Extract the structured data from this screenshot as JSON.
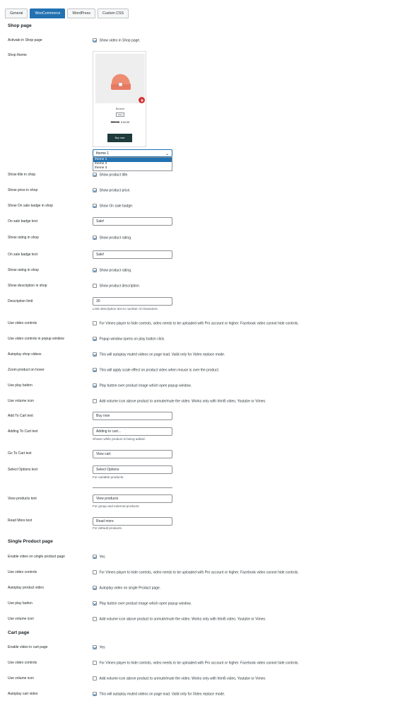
{
  "tabs": [
    "General",
    "WooCommerce",
    "WordPress",
    "Custom CSS"
  ],
  "active_tab": 1,
  "sections": {
    "shop": "Shop page",
    "single": "Single Product page",
    "cart": "Cart page"
  },
  "preview": {
    "product_name": "Beanie",
    "badge": "Sale!",
    "old_price": "£20.00",
    "price": "£18.00",
    "button": "Buy now"
  },
  "theme_select": {
    "value": "theme 1",
    "options": [
      "theme 1",
      "theme 2",
      "theme 3"
    ]
  },
  "shop_rows": [
    {
      "label": "Activate in Shop page",
      "type": "checkbox",
      "checked": true,
      "text": "Show video in Shop page."
    },
    {
      "label": "Shop theme"
    },
    {
      "label": "Show title in shop",
      "type": "checkbox",
      "checked": true,
      "text": "Show product title."
    },
    {
      "label": "Show price in shop",
      "type": "checkbox",
      "checked": true,
      "text": "Show product price."
    },
    {
      "label": "Show On sale badge in shop",
      "type": "checkbox",
      "checked": true,
      "text": "Show On sale badge."
    },
    {
      "label": "On sale badge text",
      "type": "input",
      "value": "Sale!"
    },
    {
      "label": "Show rating in shop",
      "type": "checkbox",
      "checked": true,
      "text": "Show product rating."
    },
    {
      "label": "On sale badge text",
      "type": "input",
      "value": "Sale!"
    },
    {
      "label": "Show rating in shop",
      "type": "checkbox",
      "checked": true,
      "text": "Show product rating."
    },
    {
      "label": "Show description in shop",
      "type": "checkbox",
      "checked": false,
      "text": "Show product description."
    },
    {
      "label": "Description limit",
      "type": "input",
      "value": "30",
      "desc": "Limit description text to number of characters."
    },
    {
      "label": "Use video controls",
      "type": "checkbox",
      "checked": false,
      "text": "For Vimeo player to hide controls, video needs to be uploaded with Pro account or higher. Facebook video cannot hide controls."
    },
    {
      "label": "Use video controls in popup window",
      "type": "checkbox",
      "checked": true,
      "text": "Popup window opens on play button click."
    },
    {
      "label": "Autoplay shop videos",
      "type": "checkbox",
      "checked": true,
      "text": "This will autoplay muted videos on page load. Valid only for Video replace mode."
    },
    {
      "label": "Zoom product on hover",
      "type": "checkbox",
      "checked": true,
      "text": "This will apply scale effect on product video when mouse is over the product."
    },
    {
      "label": "Use play button",
      "type": "checkbox",
      "checked": true,
      "text": "Play button over product image which open popup window."
    },
    {
      "label": "Use volume icon",
      "type": "checkbox",
      "checked": false,
      "text": "Add volume icon above product to unmute/mute the video. Works only with html5 video, Youtube or Vimeo."
    },
    {
      "label": "Add To Cart text",
      "type": "input",
      "value": "Buy now"
    },
    {
      "label": "Adding To Cart text",
      "type": "input",
      "value": "Adding to cart...",
      "desc": "Shown while product is being added."
    },
    {
      "label": "Go To Cart text",
      "type": "input",
      "value": "View cart"
    },
    {
      "label": "Select Options text",
      "type": "input",
      "value": "Select Options",
      "desc": "For variable products."
    },
    {
      "label": "View products text",
      "type": "input",
      "value": "View products",
      "desc": "For group and external products."
    },
    {
      "label": "Read More text",
      "type": "input",
      "value": "Read more",
      "desc": "For default products."
    }
  ],
  "single_rows": [
    {
      "label": "Enable video on single product page",
      "type": "checkbox",
      "checked": true,
      "text": "Yes"
    },
    {
      "label": "Use video controls",
      "type": "checkbox",
      "checked": false,
      "text": "For Vimeo player to hide controls, video needs to be uploaded with Pro account or higher. Facebook video cannot hide controls."
    },
    {
      "label": "Autoplay product video",
      "type": "checkbox",
      "checked": true,
      "text": "Autoplay video on single Product page."
    },
    {
      "label": "Use play button",
      "type": "checkbox",
      "checked": true,
      "text": "Play button over product image which open popup window."
    },
    {
      "label": "Use volume icon",
      "type": "checkbox",
      "checked": false,
      "text": "Add volume icon above product to unmute/mute the video. Works only with html5 video, Youtube or Vimeo."
    }
  ],
  "cart_rows": [
    {
      "label": "Enable video in cart page",
      "type": "checkbox",
      "checked": true,
      "text": "Yes"
    },
    {
      "label": "Use video controls",
      "type": "checkbox",
      "checked": false,
      "text": "For Vimeo player to hide controls, video needs to be uploaded with Pro account or higher. Facebook video cannot hide controls."
    },
    {
      "label": "Use volume icon",
      "type": "checkbox",
      "checked": false,
      "text": "Add volume icon above product to unmute/mute the video. Works only with html5 video, Youtube or Vimeo."
    },
    {
      "label": "Autoplay cart video",
      "type": "checkbox",
      "checked": true,
      "text": "This will autoplay muted videos on page load. Valid only for Video replace mode."
    }
  ]
}
